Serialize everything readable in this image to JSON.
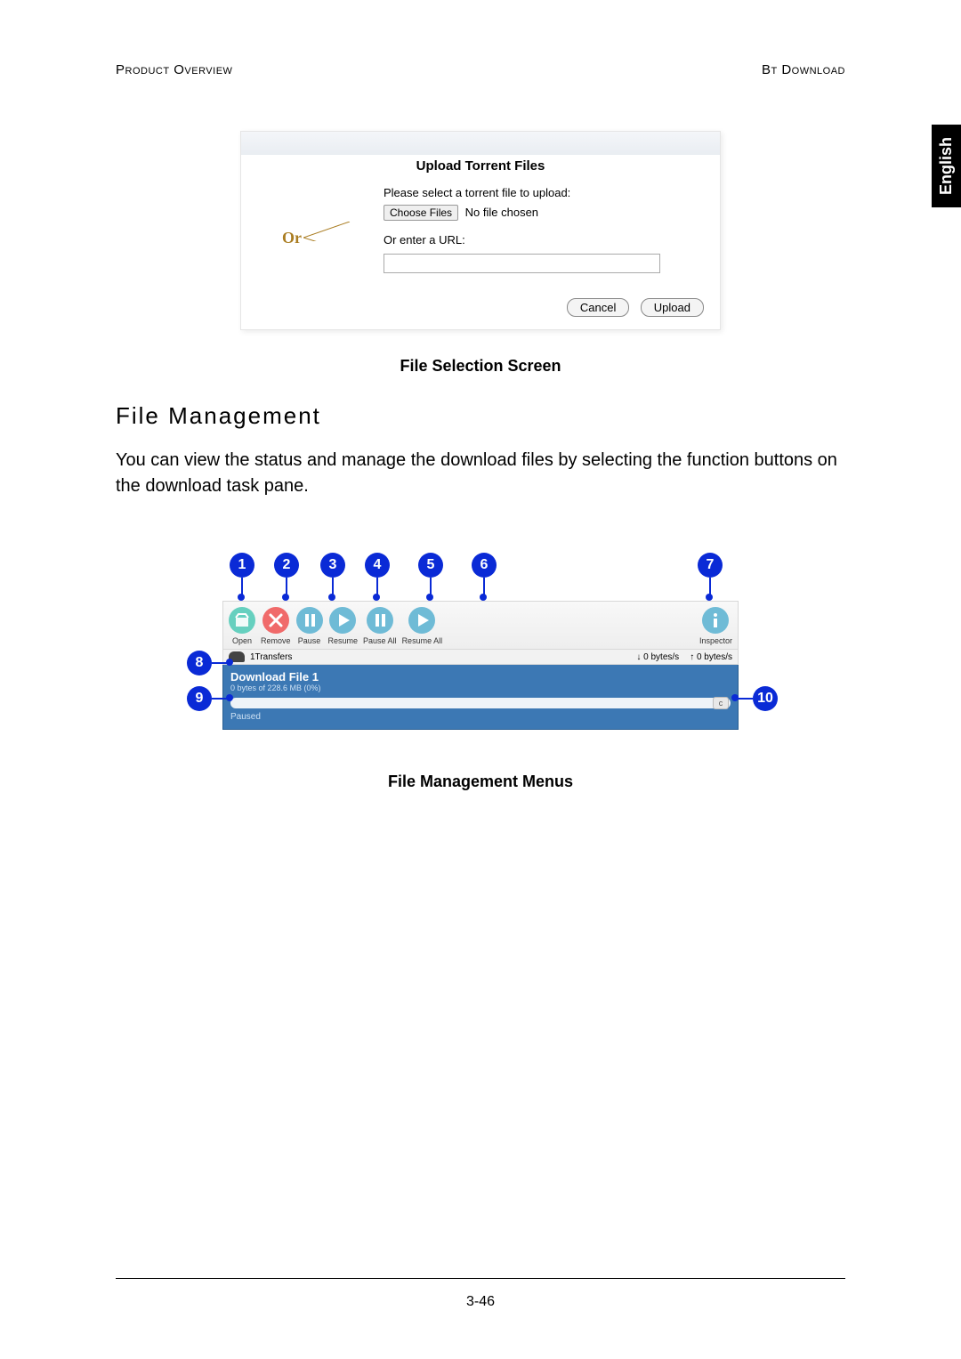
{
  "header": {
    "left": "Product Overview",
    "right": "Bt Download"
  },
  "lang_tab": "English",
  "upload_dialog": {
    "titlebar_grey": "",
    "heading": "Upload Torrent Files",
    "prompt": "Please select a torrent file to upload:",
    "choose_btn": "Choose Files",
    "no_file": "No file chosen",
    "or_label": "Or",
    "url_label": "Or enter a URL:",
    "url_value": "",
    "cancel": "Cancel",
    "upload": "Upload"
  },
  "caption1": "File Selection Screen",
  "section_title": "File Management",
  "body_text": "You can view the status and manage the download files by selecting the function buttons on the download task pane.",
  "toolbar": {
    "open": "Open",
    "remove": "Remove",
    "pause": "Pause",
    "resume": "Resume",
    "pause_all": "Pause All",
    "resume_all": "Resume All",
    "inspector": "Inspector"
  },
  "status": {
    "transfers": "1Transfers",
    "down": "0 bytes/s",
    "up": "0 bytes/s"
  },
  "download": {
    "title": "Download File 1",
    "sub": "0 bytes of 228.6 MB (0%)",
    "status": "Paused",
    "progress_icon": "c"
  },
  "callouts": {
    "c1": "1",
    "c2": "2",
    "c3": "3",
    "c4": "4",
    "c5": "5",
    "c6": "6",
    "c7": "7",
    "c8": "8",
    "c9": "9",
    "c10": "10"
  },
  "caption2": "File Management Menus",
  "page_number": "3-46"
}
